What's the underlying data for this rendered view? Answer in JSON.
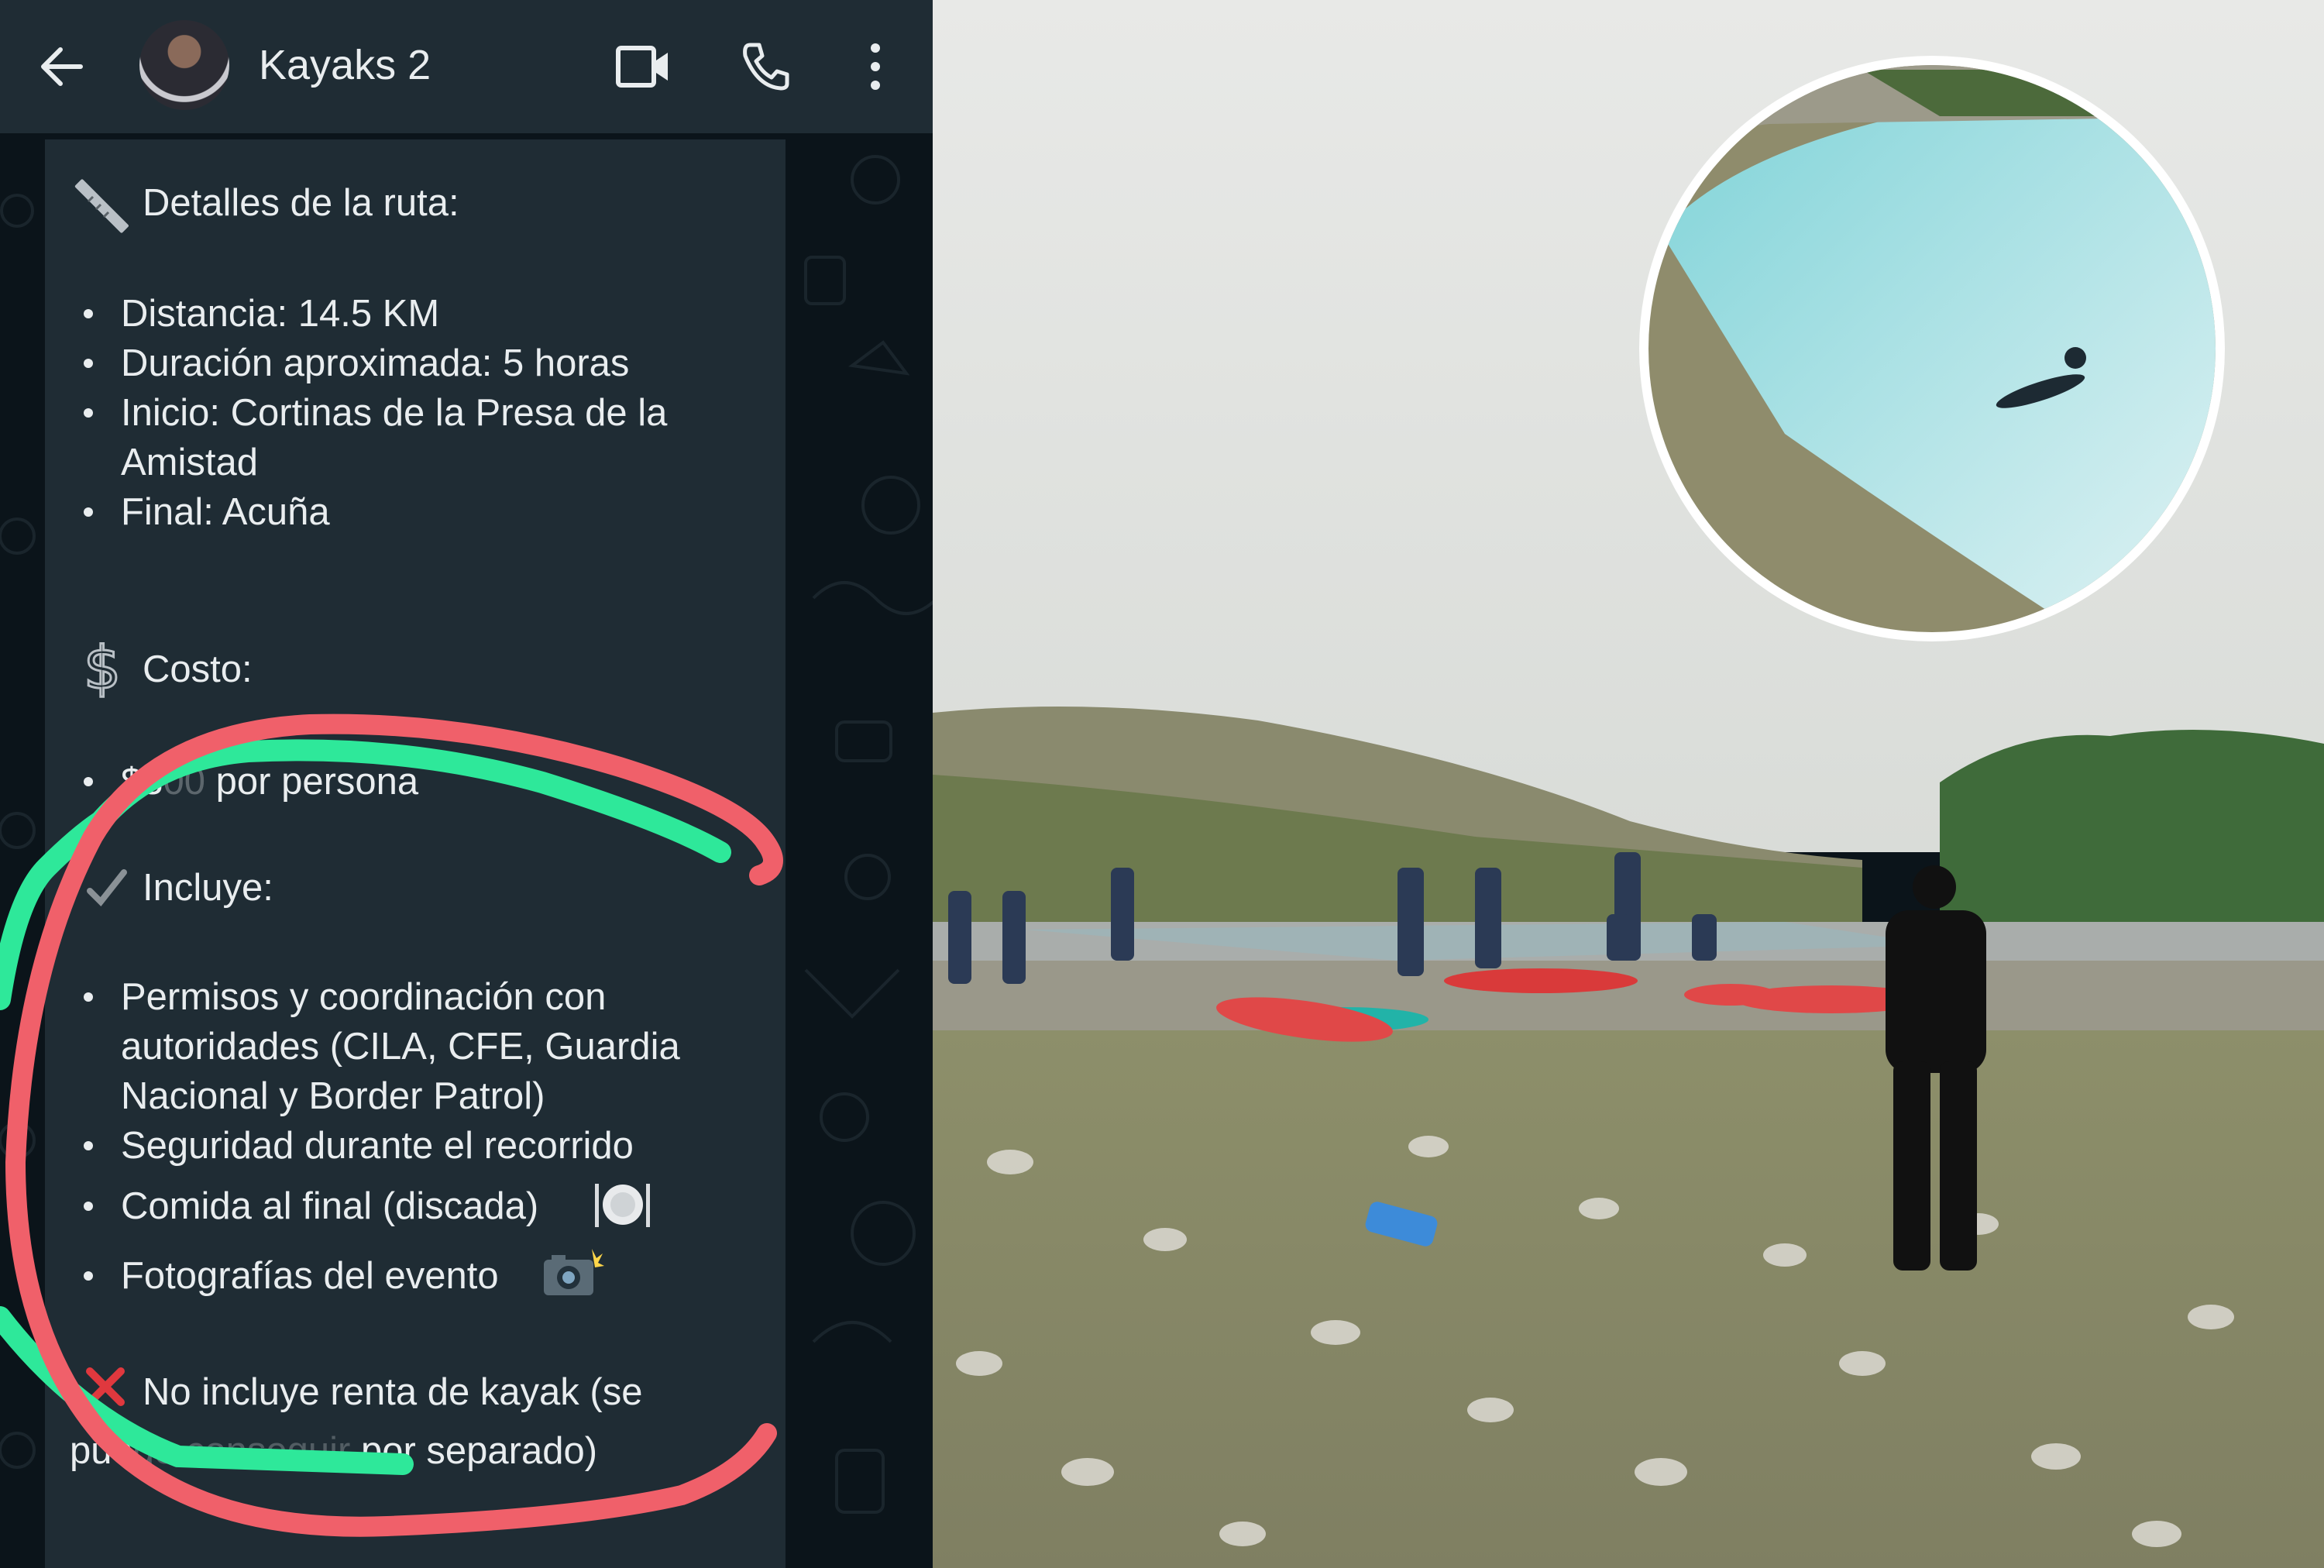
{
  "header": {
    "chat_title": "Kayaks 2"
  },
  "message": {
    "route_heading": "Detalles de la ruta:",
    "route_items": [
      "Distancia: 14.5 KM",
      "Duración aproximada: 5 horas",
      "Inicio: Cortinas de la Presa de la",
      "Amistad",
      "Final: Acuña"
    ],
    "cost_heading": "Costo:",
    "cost_item": "$3",
    "cost_item_rest": " por persona",
    "includes_heading": "Incluye:",
    "includes_items": [
      "Permisos y coordinación con",
      "autoridades (CILA, CFE, Guardia",
      "Nacional y Border Patrol)",
      "Seguridad durante el recorrido",
      "Comida al final (discada)",
      "Fotografías del evento"
    ],
    "not_included_line1": "No incluye renta de kayak (se",
    "not_included_line2_a": "pue",
    "not_included_line2_b": "por separado)"
  },
  "icons": {
    "back": "back-arrow-icon",
    "video": "video-call-icon",
    "phone": "voice-call-icon",
    "more": "more-options-icon",
    "ruler": "straight-ruler-emoji",
    "dollar": "dollar-sign-emoji",
    "check": "check-mark-emoji",
    "plate": "fork-knife-plate-emoji",
    "camera": "camera-flash-emoji",
    "cross": "cross-mark-emoji"
  },
  "colors": {
    "app_bg": "#0b141a",
    "bar_bg": "#1f2c34",
    "text": "#e9edef",
    "annotation_red": "#f0606a",
    "annotation_green": "#2ee89a"
  }
}
